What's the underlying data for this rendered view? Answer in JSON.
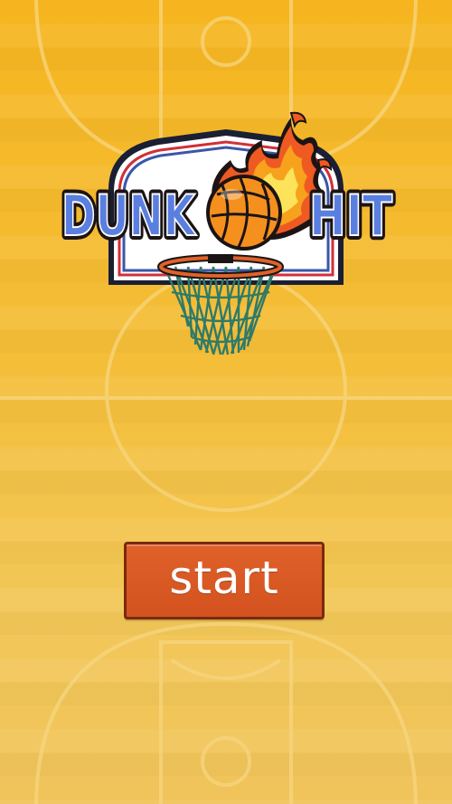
{
  "game": {
    "title_left": "DUNK",
    "title_right": "HIT",
    "start_label": "start"
  },
  "colors": {
    "court_yellow": "#f6b51f",
    "court_line": "#f7d27a",
    "title_blue": "#5a7fe0",
    "title_outline": "#16233d",
    "button_orange": "#d9571f",
    "button_border": "#7a2a0d",
    "backboard_red": "#d0303a",
    "backboard_blue": "#3a57a8",
    "rim_orange": "#e0622a",
    "net_green": "#3e8f7b"
  },
  "icons": {
    "logo": "dunk-hit-logo",
    "ball": "flaming-basketball-icon",
    "hoop": "basketball-hoop-icon"
  }
}
